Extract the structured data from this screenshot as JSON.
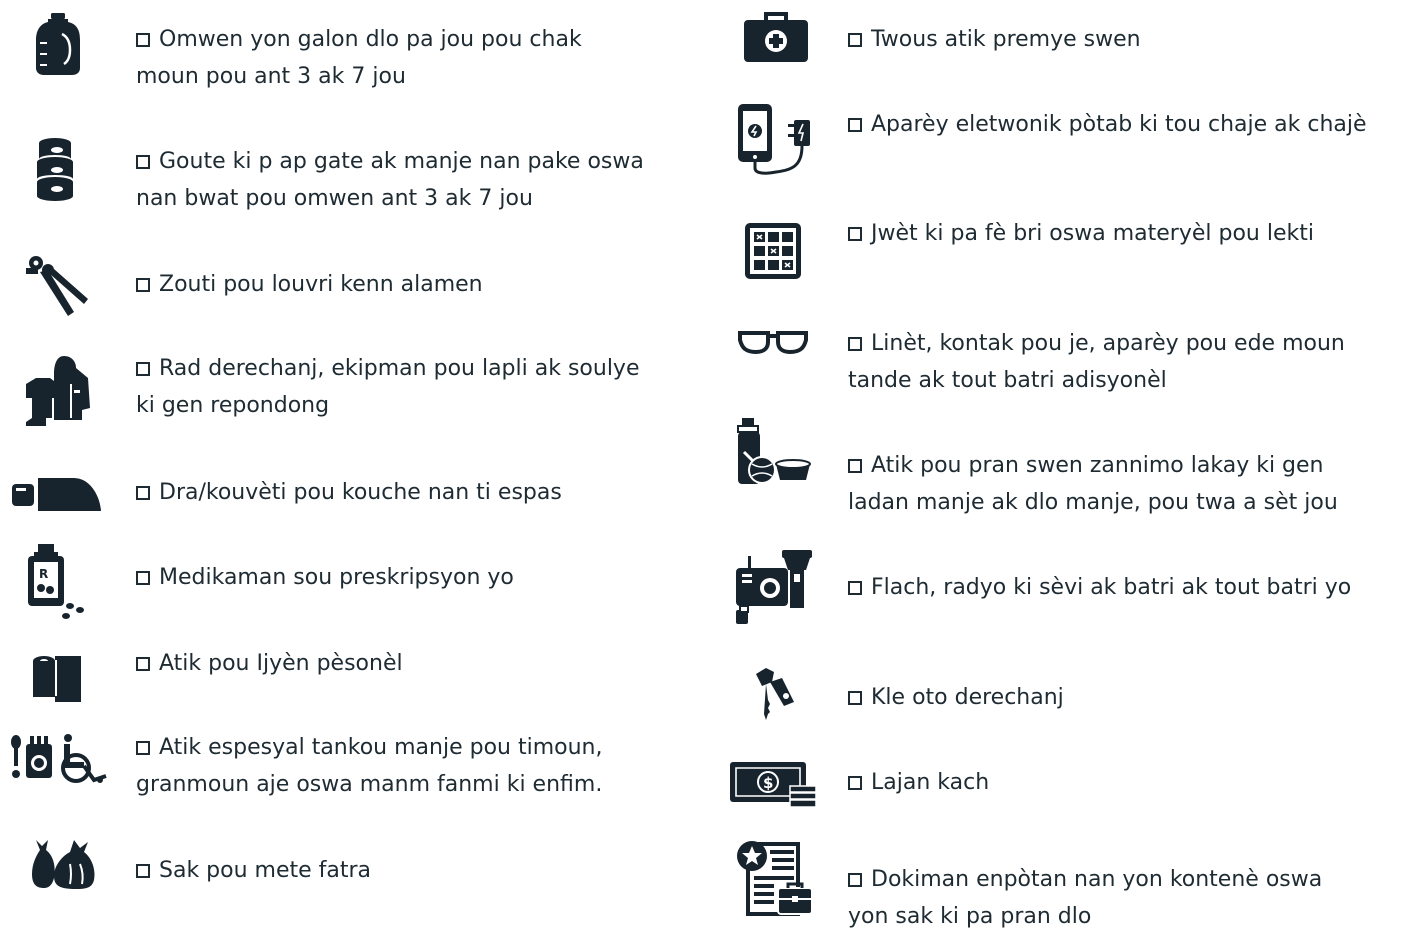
{
  "colors": {
    "icon": "#18242d",
    "text": "#1e2b33"
  },
  "left": [
    {
      "icon": "water-jug-icon",
      "lines": [
        "Omwen yon galon dlo pa jou pou chak",
        "moun pou ant 3 ak 7 jou"
      ]
    },
    {
      "icon": "canned-food-icon",
      "lines": [
        "Goute ki p ap gate ak manje nan pake oswa",
        "nan bwat pou omwen ant 3 ak 7 jou"
      ]
    },
    {
      "icon": "can-opener-icon",
      "lines": [
        "Zouti pou louvri kenn alamen"
      ]
    },
    {
      "icon": "rain-gear-icon",
      "lines": [
        "Rad derechanj, ekipman pou lapli ak soulye",
        "ki gen repondong"
      ]
    },
    {
      "icon": "sleeping-bag-icon",
      "lines": [
        "Dra/kouvèti pou kouche nan ti espas"
      ]
    },
    {
      "icon": "prescription-bottle-icon",
      "lines": [
        "Medikaman sou preskripsyon yo"
      ]
    },
    {
      "icon": "toilet-paper-icon",
      "lines": [
        "Atik pou Ijyèn pèsonèl"
      ]
    },
    {
      "icon": "special-needs-icon",
      "lines": [
        "Atik espesyal tankou manje pou timoun,",
        "granmoun aje oswa manm fanmi ki enfim."
      ]
    },
    {
      "icon": "trash-bags-icon",
      "lines": [
        "Sak pou mete fatra"
      ]
    }
  ],
  "right": [
    {
      "icon": "first-aid-kit-icon",
      "lines": [
        "Twous atik premye swen"
      ]
    },
    {
      "icon": "phone-charger-icon",
      "lines": [
        "Aparèy eletwonik pòtab ki tou chaje ak chajè"
      ]
    },
    {
      "icon": "game-board-icon",
      "lines": [
        "Jwèt ki pa fè bri oswa materyèl pou lekti"
      ]
    },
    {
      "icon": "eyeglasses-icon",
      "lines": [
        "Linèt, kontak pou je, aparèy pou ede moun",
        "tande ak tout batri adisyonèl"
      ]
    },
    {
      "icon": "pet-supplies-icon",
      "lines": [
        "Atik pou pran swen zannimo lakay ki gen",
        "ladan manje ak dlo manje, pou twa a sèt jou"
      ]
    },
    {
      "icon": "flashlight-radio-icon",
      "lines": [
        "Flach, radyo ki sèvi ak batri ak tout batri yo"
      ]
    },
    {
      "icon": "car-keys-icon",
      "lines": [
        "Kle oto derechanj"
      ]
    },
    {
      "icon": "cash-icon",
      "lines": [
        "Lajan kach"
      ]
    },
    {
      "icon": "documents-icon",
      "lines": [
        "Dokiman enpòtan nan yon kontenè oswa",
        "yon sak ki pa pran dlo"
      ]
    }
  ]
}
